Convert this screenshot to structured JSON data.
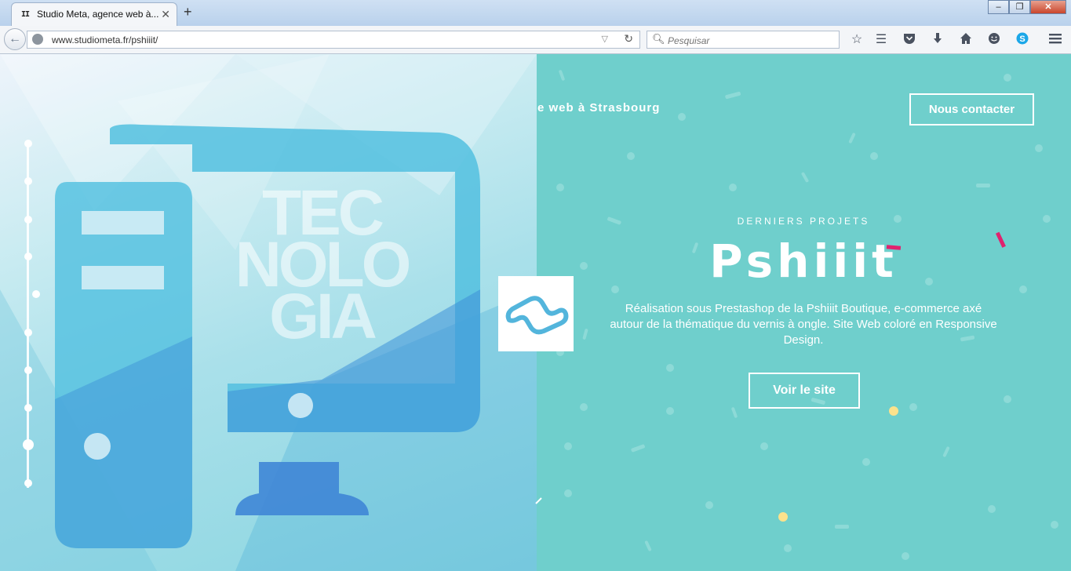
{
  "browser": {
    "tab_title": "Studio Meta, agence web à...",
    "tab_favicon": "II",
    "new_tab": "+",
    "url": "www.studiometa.fr/pshiiit/",
    "search_placeholder": "Pesquisar",
    "window_buttons": [
      "–",
      "❐",
      "✕"
    ],
    "toolbar_icons": [
      "star-icon",
      "reading-list-icon",
      "pocket-icon",
      "download-icon",
      "home-icon",
      "smiley-icon",
      "skype-icon",
      "menu-icon"
    ]
  },
  "page": {
    "tagline": "e web à Strasbourg",
    "contact_label": "Nous contacter",
    "hero_text": [
      "TEC",
      "NOLO",
      "GIA"
    ],
    "section_label": "DERNIERS PROJETS",
    "project_title": "Pshiiit",
    "project_description": "Réalisation sous Prestashop de la Pshiiit Boutique, e-commerce axé autour de la thématique du vernis à ongle. Site Web coloré en Responsive Design.",
    "cta_label": "Voir le site",
    "accent_color": "#6fcfcc",
    "pink_accent": "#e0226e",
    "yellow_accent": "#fbe28c"
  }
}
